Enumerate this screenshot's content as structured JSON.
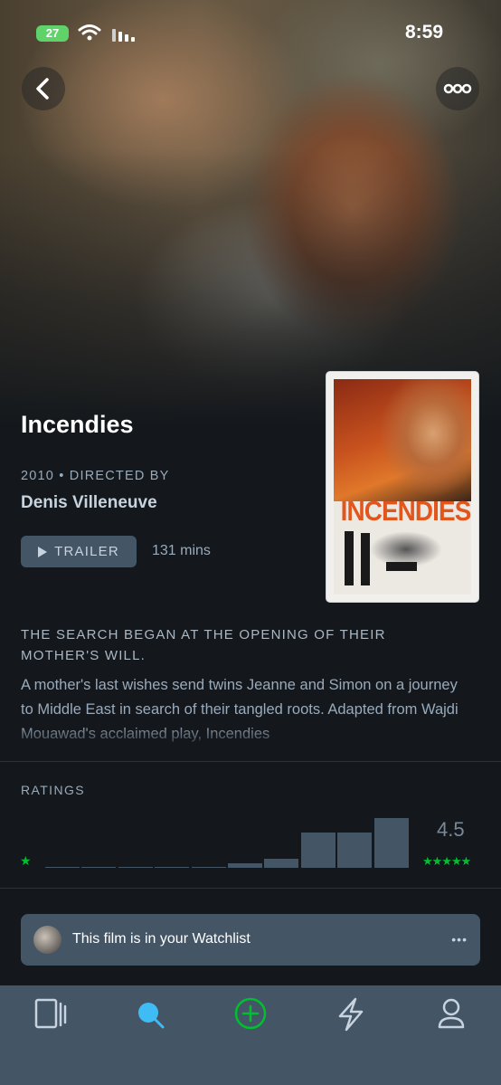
{
  "status_bar": {
    "battery": "27",
    "time": "8:59"
  },
  "film": {
    "title": "Incendies",
    "year": "2010",
    "meta_separator": " • ",
    "directed_by_label": "DIRECTED BY",
    "director": "Denis Villeneuve",
    "trailer_label": "TRAILER",
    "runtime": "131 mins",
    "poster_title": "INCENDIES",
    "tagline": "THE SEARCH BEGAN AT THE OPENING OF THEIR MOTHER'S WILL.",
    "synopsis": "A mother's last wishes send twins Jeanne and Simon on a journey to Middle East in search of their tangled roots. Adapted from Wajdi Mouawad's acclaimed play, Incendies"
  },
  "ratings": {
    "label": "RATINGS",
    "average": "4.5",
    "left_star": "★",
    "right_stars": "★★★★★",
    "histogram": [
      0.01,
      0.01,
      0.01,
      0.01,
      0.01,
      0.08,
      0.18,
      0.68,
      0.68,
      0.97
    ],
    "accent_color": "#00c030"
  },
  "watchlist": {
    "text": "This film is in your Watchlist",
    "more": "•••"
  },
  "icons": {
    "back": "chevron-left-icon",
    "more": "more-horizontal-icon",
    "tabs": [
      "films-icon",
      "search-icon",
      "add-icon",
      "activity-icon",
      "profile-icon"
    ]
  },
  "colors": {
    "background": "#14181c",
    "surface": "#445566",
    "text_muted": "#99aabb",
    "search_active": "#40bcf4",
    "add_active": "#00c030"
  }
}
